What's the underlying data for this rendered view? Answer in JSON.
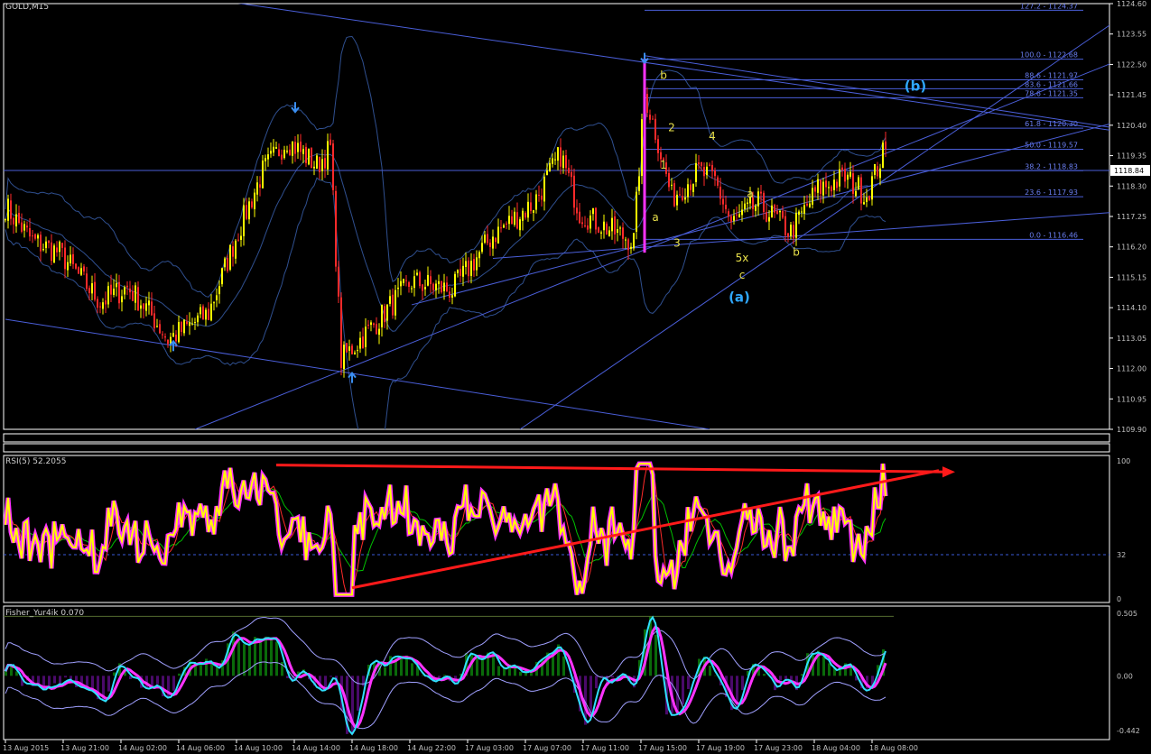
{
  "window": {
    "title": "GOLD,M15"
  },
  "colors": {
    "background": "#000000",
    "grid_frame": "#ffffff",
    "axis_text": "#c0c0c0",
    "bull_candle": "#ffff00",
    "bear_candle": "#ff2a2a",
    "bollinger": "#2f4f8f",
    "trendline": "#4a5ed8",
    "fib": "#4a5ed8",
    "fib_label": "#6a7ef0",
    "wave_label": "#e8e04a",
    "wave_label_big": "#2fa8ff",
    "arrow": "#3a8ef0",
    "rsi_main": "#ffff00",
    "rsi_glow": "#ff33ff",
    "rsi_signal": "#ff2a2a",
    "rsi_slow": "#00c000",
    "rsi_trend": "#ff1a1a",
    "fisher_up": "#0a6a0a",
    "fisher_down": "#4a0a6a",
    "fisher_fast": "#30e0ff",
    "fisher_mid": "#ff33ff",
    "fisher_slow": "#a0a0ff",
    "fisher_band": "#8ad0ff",
    "price_tag_bg": "#ffffff",
    "price_tag_text": "#000000"
  },
  "chart_data": [
    {
      "type": "candlestick",
      "title": "GOLD,M15",
      "ylim": [
        1109.9,
        1124.6
      ],
      "yticks": [
        "1124.60",
        "1123.55",
        "1122.50",
        "1121.45",
        "1120.40",
        "1119.35",
        "1118.30",
        "1117.25",
        "1116.20",
        "1115.15",
        "1114.10",
        "1113.05",
        "1112.00",
        "1110.95",
        "1109.90"
      ],
      "current_price": "1118.84",
      "xticks": [
        "13 Aug 2015",
        "13 Aug 21:00",
        "14 Aug 02:00",
        "14 Aug 06:00",
        "14 Aug 10:00",
        "14 Aug 14:00",
        "14 Aug 18:00",
        "14 Aug 22:00",
        "17 Aug 03:00",
        "17 Aug 07:00",
        "17 Aug 11:00",
        "17 Aug 15:00",
        "17 Aug 19:00",
        "17 Aug 23:00",
        "18 Aug 04:00",
        "18 Aug 08:00"
      ],
      "fibonacci": [
        {
          "label": "127.2 - 1124.37",
          "price": 1124.37
        },
        {
          "label": "100.0 - 1122.68",
          "price": 1122.68
        },
        {
          "label": "88.6 - 1121.97",
          "price": 1121.97
        },
        {
          "label": "83.6 - 1121.66",
          "price": 1121.66
        },
        {
          "label": "78.6 - 1121.35",
          "price": 1121.35
        },
        {
          "label": "61.8 - 1120.30",
          "price": 1120.3
        },
        {
          "label": "50.0 - 1119.57",
          "price": 1119.57
        },
        {
          "label": "38.2 - 1118.83",
          "price": 1118.83
        },
        {
          "label": "23.6 - 1117.93",
          "price": 1117.93
        },
        {
          "label": "0.0 - 1116.46",
          "price": 1116.46
        }
      ],
      "wave_labels": [
        "b",
        "2",
        "1",
        "a",
        "3",
        "4",
        "a",
        "5x",
        "c",
        "b",
        "(a)",
        "(b)"
      ],
      "anchors": [
        {
          "t": 0,
          "p": 1117.6
        },
        {
          "t": 10,
          "p": 1116.4
        },
        {
          "t": 20,
          "p": 1116.0
        },
        {
          "t": 35,
          "p": 1114.3
        },
        {
          "t": 45,
          "p": 1114.8
        },
        {
          "t": 52,
          "p": 1114.1
        },
        {
          "t": 60,
          "p": 1113.0
        },
        {
          "t": 75,
          "p": 1113.9
        },
        {
          "t": 85,
          "p": 1116.5
        },
        {
          "t": 95,
          "p": 1118.8
        },
        {
          "t": 104,
          "p": 1119.9
        },
        {
          "t": 115,
          "p": 1119.0
        },
        {
          "t": 120,
          "p": 1119.6
        },
        {
          "t": 124,
          "p": 1112.3
        },
        {
          "t": 135,
          "p": 1113.4
        },
        {
          "t": 150,
          "p": 1115.0
        },
        {
          "t": 165,
          "p": 1114.7
        },
        {
          "t": 180,
          "p": 1116.6
        },
        {
          "t": 195,
          "p": 1117.7
        },
        {
          "t": 205,
          "p": 1119.4
        },
        {
          "t": 212,
          "p": 1117.4
        },
        {
          "t": 225,
          "p": 1116.7
        },
        {
          "t": 232,
          "p": 1116.4
        },
        {
          "t": 236,
          "p": 1121.5
        },
        {
          "t": 240,
          "p": 1120.2
        },
        {
          "t": 246,
          "p": 1117.9
        },
        {
          "t": 256,
          "p": 1118.8
        },
        {
          "t": 262,
          "p": 1118.5
        },
        {
          "t": 268,
          "p": 1117.0
        },
        {
          "t": 278,
          "p": 1117.7
        },
        {
          "t": 290,
          "p": 1116.7
        },
        {
          "t": 300,
          "p": 1118.2
        },
        {
          "t": 310,
          "p": 1118.6
        },
        {
          "t": 318,
          "p": 1118.0
        },
        {
          "t": 324,
          "p": 1119.4
        }
      ],
      "candle_count": 326
    },
    {
      "type": "line",
      "title": "RSI(5) 52.2055",
      "ylim": [
        0,
        100
      ],
      "yticks": [
        "100",
        "32",
        "0"
      ]
    },
    {
      "type": "histogram",
      "title": "Fisher_Yur4ik 0.070",
      "ylim": [
        -0.442,
        0.505
      ],
      "yticks": [
        "0.505",
        "0.00",
        "-0.442"
      ]
    }
  ]
}
